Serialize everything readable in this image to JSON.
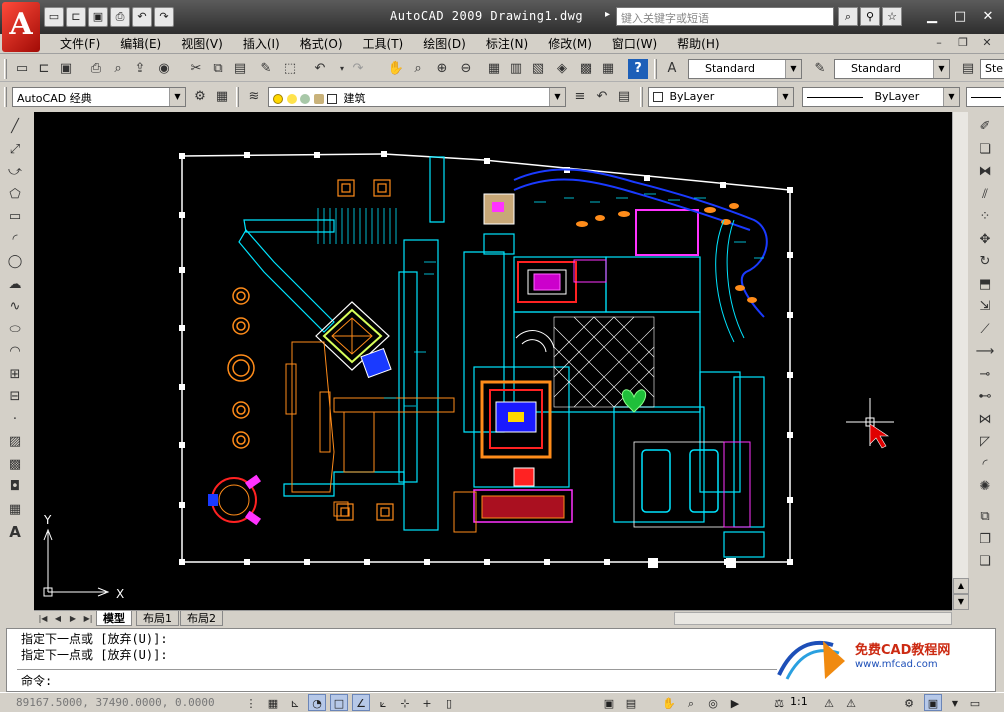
{
  "app": {
    "logo_letter": "A",
    "window_title": "AutoCAD 2009 Drawing1.dwg",
    "help_search_placeholder": "键入关键字或短语",
    "quick_access": [
      "new-icon",
      "open-icon",
      "save-icon",
      "print-icon",
      "undo-icon",
      "redo-icon"
    ]
  },
  "menu": {
    "items": [
      {
        "label": "文件(F)"
      },
      {
        "label": "编辑(E)"
      },
      {
        "label": "视图(V)"
      },
      {
        "label": "插入(I)"
      },
      {
        "label": "格式(O)"
      },
      {
        "label": "工具(T)"
      },
      {
        "label": "绘图(D)"
      },
      {
        "label": "标注(N)"
      },
      {
        "label": "修改(M)"
      },
      {
        "label": "窗口(W)"
      },
      {
        "label": "帮助(H)"
      }
    ]
  },
  "toolbar": {
    "text_style": "Standard",
    "dim_style": "Standard",
    "table_style_short": "Ste",
    "workspace": "AutoCAD 经典",
    "layer": "建筑",
    "color": "ByLayer",
    "linetype": "ByLayer"
  },
  "tabs": {
    "model": "模型",
    "layout1": "布局1",
    "layout2": "布局2"
  },
  "axes": {
    "y": "Y",
    "x": "X"
  },
  "command": {
    "history1": "指定下一点或 [放弃(U)]:",
    "history2": "指定下一点或 [放弃(U)]:",
    "prompt": "命令:"
  },
  "watermark": {
    "name": "免费CAD教程网",
    "url": "www.mfcad.com"
  },
  "status": {
    "coordinates": "89167.5000, 37490.0000, 0.0000",
    "scale": "1:1"
  },
  "colors": {
    "canvas": "#000000",
    "titlebar": "#3c3c3c",
    "accent_red": "#c8190f"
  }
}
